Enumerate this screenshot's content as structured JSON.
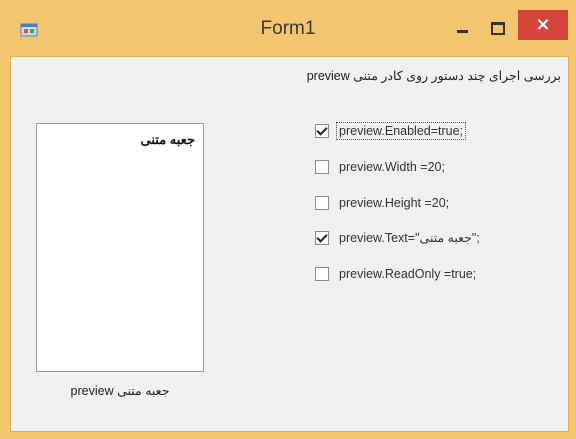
{
  "window": {
    "title": "Form1",
    "close_glyph": "×"
  },
  "form": {
    "heading": "بررسی اجرای چند دستور روی کادر متنی preview",
    "textbox_text": "جعبه متنی",
    "textbox_caption": "جعبه متنی preview"
  },
  "checkboxes": [
    {
      "label": "preview.Enabled=true;",
      "checked": true,
      "focused": true
    },
    {
      "label": "preview.Width =20;",
      "checked": false,
      "focused": false
    },
    {
      "label": "preview.Height =20;",
      "checked": false,
      "focused": false
    },
    {
      "label": "preview.Text=\"جعبه متنی\";",
      "checked": true,
      "focused": false
    },
    {
      "label": "preview.ReadOnly =true;",
      "checked": false,
      "focused": false
    }
  ],
  "colors": {
    "frame": "#f3c56e",
    "close_button": "#d5453c",
    "client_background": "#f0f0f0"
  }
}
